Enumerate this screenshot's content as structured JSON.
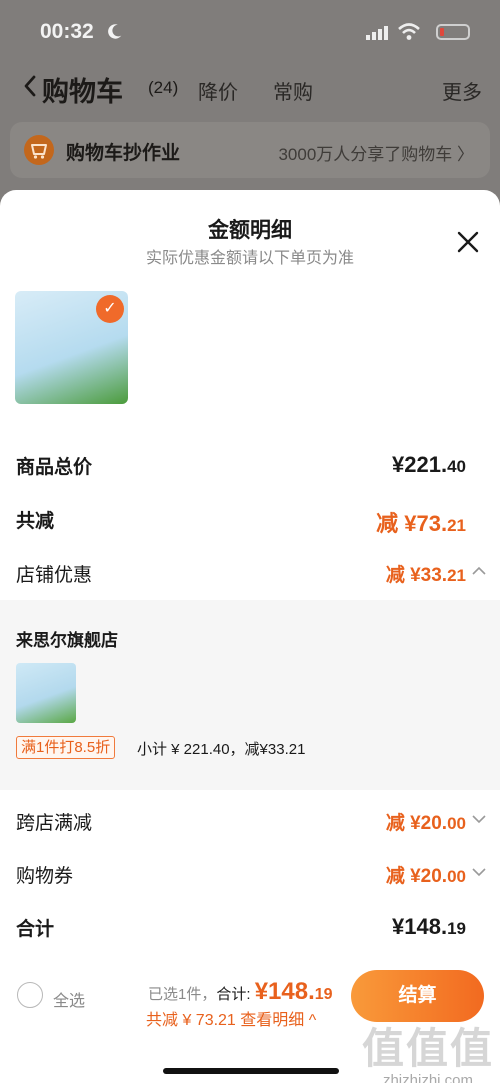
{
  "status_bar": {
    "time": "00:32"
  },
  "nav": {
    "title": "购物车",
    "count": "(24)",
    "tab_price_drop": "降价",
    "tab_frequent": "常购",
    "more": "更多"
  },
  "banner": {
    "title": "购物车抄作业",
    "subtitle": "3000万人分享了购物车 〉"
  },
  "sheet": {
    "title": "金额明细",
    "subtitle": "实际优惠金额请以下单页为准",
    "product_check": "✓",
    "rows": {
      "goods_total_label": "商品总价",
      "goods_total_value": "¥221.",
      "goods_total_cents": "40",
      "total_reduce_label": "共减",
      "total_reduce_value": "减 ¥73.",
      "total_reduce_cents": "21",
      "shop_discount_label": "店铺优惠",
      "shop_discount_value": "减 ¥33.",
      "shop_discount_cents": "21",
      "cross_store_label": "跨店满减",
      "cross_store_value": "减 ¥20.",
      "cross_store_cents": "00",
      "coupon_label": "购物券",
      "coupon_value": "减 ¥20.",
      "coupon_cents": "00",
      "sum_label": "合计",
      "sum_value": "¥148.",
      "sum_cents": "19"
    },
    "shop": {
      "name": "来思尔旗舰店",
      "promo_tag": "满1件打8.5折",
      "subtotal": "小计 ¥ 221.40，减¥33.21"
    }
  },
  "bottom_bar": {
    "select_all": "全选",
    "picked": "已选1件，",
    "total_label": "合计:",
    "total_value": "¥148.",
    "total_cents": "19",
    "reduce_detail": "共减 ¥ 73.21  查看明细 ^",
    "checkout": "结算"
  },
  "watermark": {
    "text": "值值值",
    "url": "zhizhizhi.com"
  },
  "colors": {
    "accent": "#e8611d",
    "checkout_start": "#f99a3a",
    "checkout_end": "#f26a20"
  },
  "icons": [
    "moon-icon",
    "signal-icon",
    "wifi-icon",
    "battery-icon",
    "back-icon",
    "cart-icon",
    "close-icon",
    "chevron-up-icon",
    "chevron-down-icon",
    "check-icon"
  ]
}
